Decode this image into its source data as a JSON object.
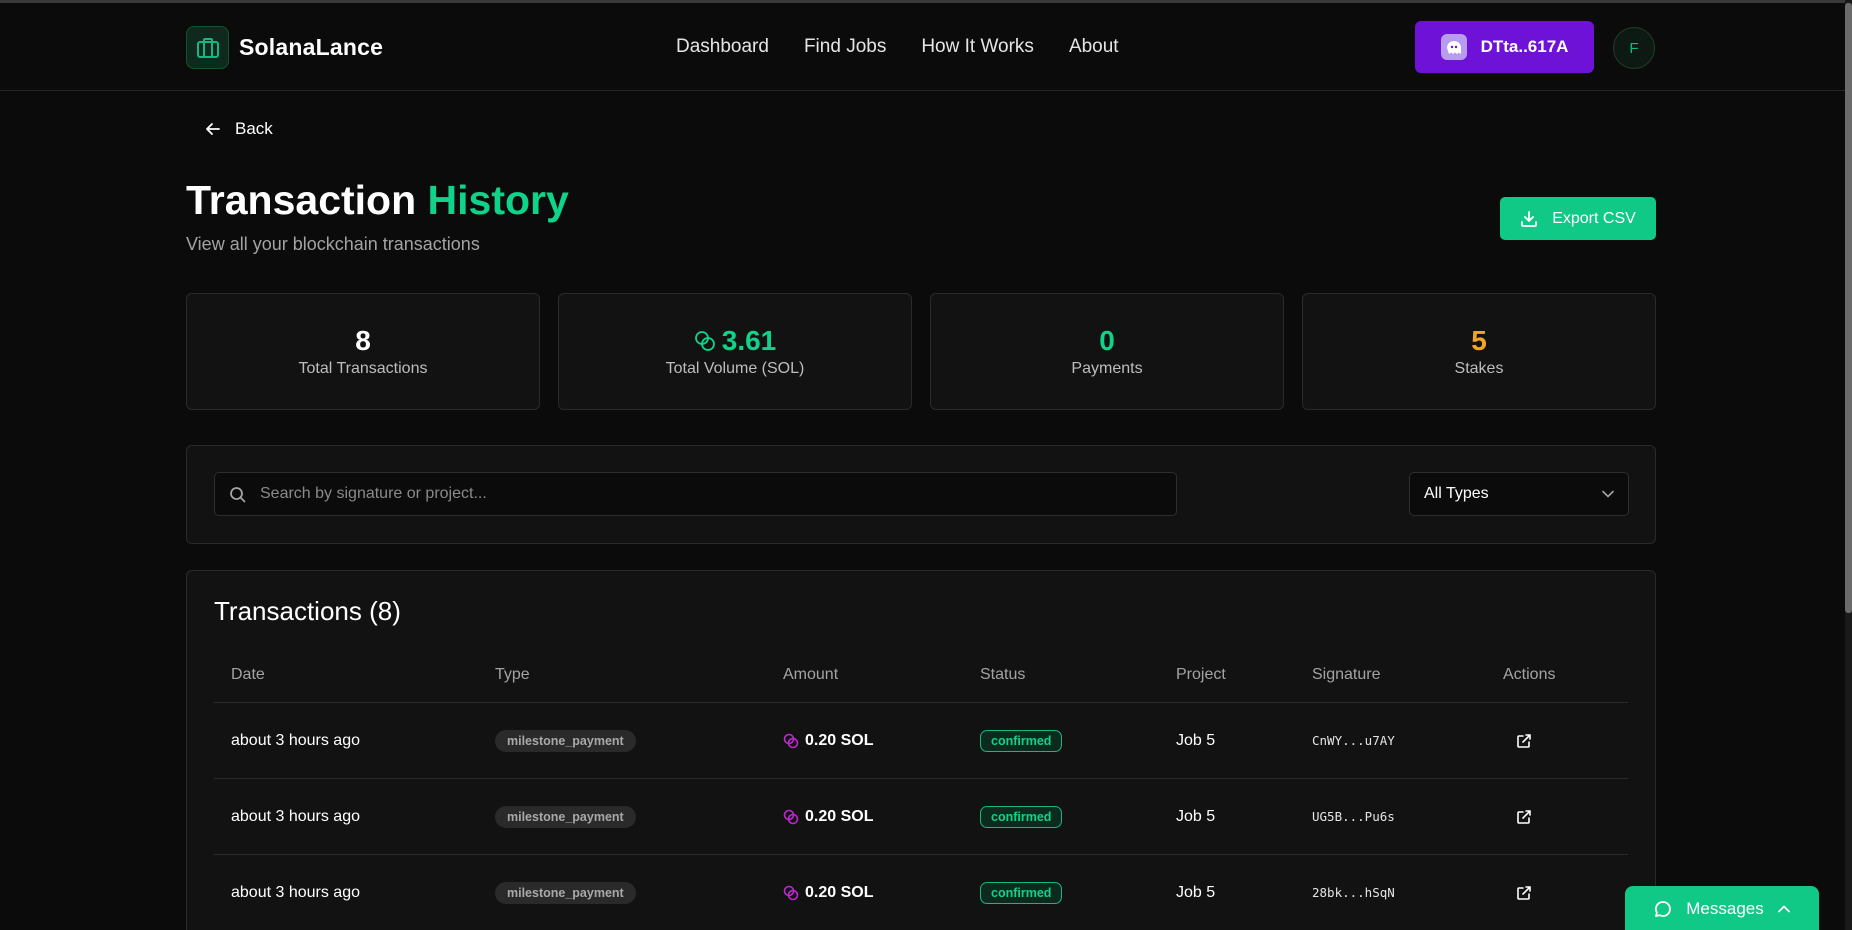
{
  "brand": {
    "name": "SolanaLance"
  },
  "nav": {
    "links": [
      "Dashboard",
      "Find Jobs",
      "How It Works",
      "About"
    ]
  },
  "wallet": {
    "label": "DTta..617A"
  },
  "user": {
    "initial": "F"
  },
  "page": {
    "back_label": "Back",
    "title_main": "Transaction",
    "title_accent": "History",
    "subtitle": "View all your blockchain transactions",
    "export_label": "Export CSV"
  },
  "stats": [
    {
      "value": "8",
      "label": "Total Transactions",
      "color": "#ffffff"
    },
    {
      "value": "3.61",
      "label": "Total Volume (SOL)",
      "color": "#10d38a"
    },
    {
      "value": "0",
      "label": "Payments",
      "color": "#10d38a"
    },
    {
      "value": "5",
      "label": "Stakes",
      "color": "#f5a524"
    }
  ],
  "filters": {
    "search_placeholder": "Search by signature or project...",
    "type_selected": "All Types"
  },
  "transactions": {
    "heading": "Transactions (8)",
    "columns": [
      "Date",
      "Type",
      "Amount",
      "Status",
      "Project",
      "Signature",
      "Actions"
    ],
    "rows": [
      {
        "date": "about 3 hours ago",
        "type": "milestone_payment",
        "amount": "0.20 SOL",
        "status": "confirmed",
        "project": "Job 5",
        "signature": "CnWY...u7AY"
      },
      {
        "date": "about 3 hours ago",
        "type": "milestone_payment",
        "amount": "0.20 SOL",
        "status": "confirmed",
        "project": "Job 5",
        "signature": "UG5B...Pu6s"
      },
      {
        "date": "about 3 hours ago",
        "type": "milestone_payment",
        "amount": "0.20 SOL",
        "status": "confirmed",
        "project": "Job 5",
        "signature": "28bk...hSqN"
      }
    ]
  },
  "messages": {
    "label": "Messages"
  },
  "colors": {
    "accent": "#10d38a",
    "wallet": "#6d12d6",
    "sol_icon": "#c026d3"
  }
}
